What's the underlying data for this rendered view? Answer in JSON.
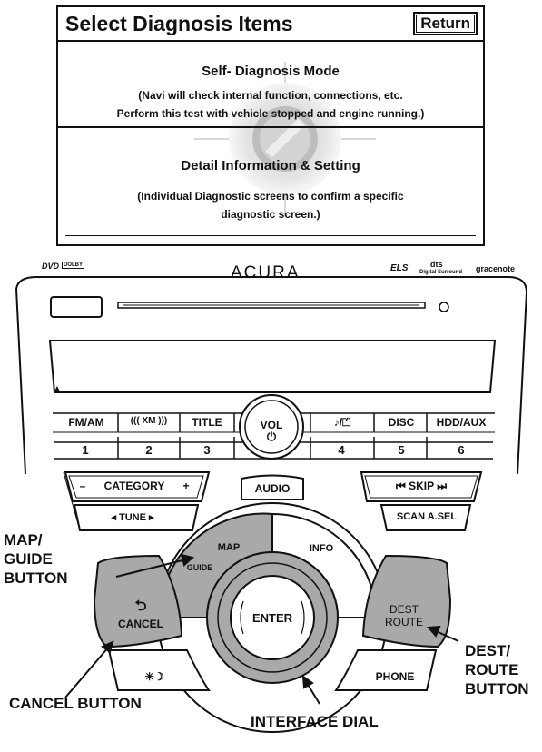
{
  "screen": {
    "title": "Select Diagnosis Items",
    "return_label": "Return",
    "options": [
      {
        "title": "Self- Diagnosis Mode",
        "desc_line1": "(Navi will check internal function, connections, etc.",
        "desc_line2": "Perform this test with vehicle stopped and engine running.)"
      },
      {
        "title": "Detail Information & Setting",
        "desc_line1": "(Individual Diagnostic screens to confirm a specific",
        "desc_line2": "diagnostic screen.)"
      }
    ]
  },
  "unit": {
    "brand": "ACURA",
    "logo_dvd": "DVD",
    "logo_dolby": "DOLBY",
    "logo_els": "ELS",
    "logo_dts": "dts",
    "logo_dts_sub": "Digital Surround",
    "logo_gracenote": "gracenote",
    "eject_symbol": "▲",
    "preset_buttons": [
      "FM/AM",
      "((( XM )))",
      "TITLE",
      "♪/⏍",
      "DISC",
      "HDD/AUX"
    ],
    "preset_numbers": [
      "1",
      "2",
      "3",
      "4",
      "5",
      "6"
    ],
    "vol_label": "VOL",
    "power_symbol": "⏻",
    "category_label": "CATEGORY",
    "category_minus": "–",
    "category_plus": "+",
    "tune_label": "TUNE",
    "skip_label": "SKIP",
    "scan_label": "SCAN A.SEL",
    "audio_label": "AUDIO",
    "map_label": "MAP",
    "guide_label": "GUIDE",
    "info_label": "INFO",
    "cancel_label": "CANCEL",
    "enter_label": "ENTER",
    "dest_label": "DEST",
    "route_label": "ROUTE",
    "phone_label": "PHONE",
    "daynight_symbol": "✳☽"
  },
  "callouts": {
    "map_guide": [
      "MAP/",
      "GUIDE",
      "BUTTON"
    ],
    "dest_route": [
      "DEST/",
      "ROUTE",
      "BUTTON"
    ],
    "cancel": "CANCEL BUTTON",
    "interface_dial": "INTERFACE DIAL"
  },
  "colors": {
    "highlight_gray": "#a9a9a9",
    "line": "#111111"
  }
}
